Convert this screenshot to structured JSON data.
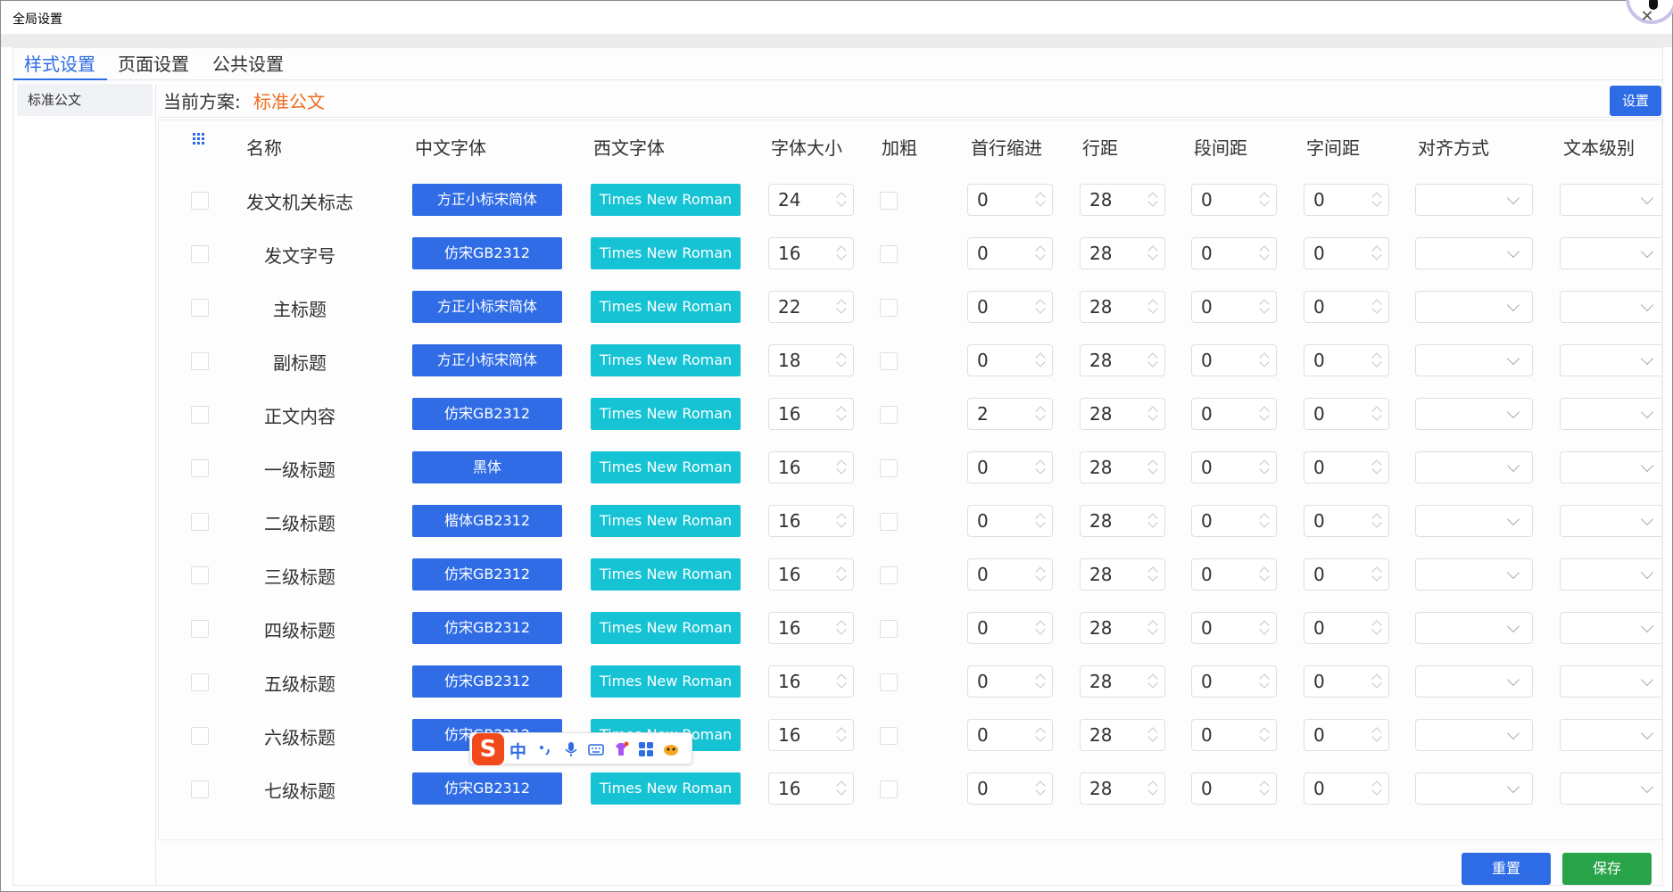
{
  "window": {
    "title": "全局设置"
  },
  "tabs": [
    {
      "label": "样式设置",
      "active": true
    },
    {
      "label": "页面设置",
      "active": false
    },
    {
      "label": "公共设置",
      "active": false
    }
  ],
  "sidebar": {
    "schemes": [
      "标准公文"
    ]
  },
  "scheme": {
    "label": "当前方案:",
    "value": "标准公文",
    "settings_button": "设置",
    "value_color": "#ef6b1f"
  },
  "table": {
    "headers": {
      "name": "名称",
      "cn_font": "中文字体",
      "en_font": "西文字体",
      "size": "字体大小",
      "bold": "加粗",
      "indent": "首行缩进",
      "line_spacing": "行距",
      "para_spacing": "段间距",
      "char_spacing": "字间距",
      "align": "对齐方式",
      "level": "文本级别"
    },
    "rows": [
      {
        "name": "发文机关标志",
        "cn_font": "方正小标宋简体",
        "en_font": "Times New Roman",
        "size": "24",
        "indent": "0",
        "line": "28",
        "para": "0",
        "char": "0"
      },
      {
        "name": "发文字号",
        "cn_font": "仿宋GB2312",
        "en_font": "Times New Roman",
        "size": "16",
        "indent": "0",
        "line": "28",
        "para": "0",
        "char": "0"
      },
      {
        "name": "主标题",
        "cn_font": "方正小标宋简体",
        "en_font": "Times New Roman",
        "size": "22",
        "indent": "0",
        "line": "28",
        "para": "0",
        "char": "0"
      },
      {
        "name": "副标题",
        "cn_font": "方正小标宋简体",
        "en_font": "Times New Roman",
        "size": "18",
        "indent": "0",
        "line": "28",
        "para": "0",
        "char": "0"
      },
      {
        "name": "正文内容",
        "cn_font": "仿宋GB2312",
        "en_font": "Times New Roman",
        "size": "16",
        "indent": "2",
        "line": "28",
        "para": "0",
        "char": "0"
      },
      {
        "name": "一级标题",
        "cn_font": "黑体",
        "en_font": "Times New Roman",
        "size": "16",
        "indent": "0",
        "line": "28",
        "para": "0",
        "char": "0"
      },
      {
        "name": "二级标题",
        "cn_font": "楷体GB2312",
        "en_font": "Times New Roman",
        "size": "16",
        "indent": "0",
        "line": "28",
        "para": "0",
        "char": "0"
      },
      {
        "name": "三级标题",
        "cn_font": "仿宋GB2312",
        "en_font": "Times New Roman",
        "size": "16",
        "indent": "0",
        "line": "28",
        "para": "0",
        "char": "0"
      },
      {
        "name": "四级标题",
        "cn_font": "仿宋GB2312",
        "en_font": "Times New Roman",
        "size": "16",
        "indent": "0",
        "line": "28",
        "para": "0",
        "char": "0"
      },
      {
        "name": "五级标题",
        "cn_font": "仿宋GB2312",
        "en_font": "Times New Roman",
        "size": "16",
        "indent": "0",
        "line": "28",
        "para": "0",
        "char": "0"
      },
      {
        "name": "六级标题",
        "cn_font": "仿宋GB2312",
        "en_font": "Times New Roman",
        "size": "16",
        "indent": "0",
        "line": "28",
        "para": "0",
        "char": "0"
      },
      {
        "name": "七级标题",
        "cn_font": "仿宋GB2312",
        "en_font": "Times New Roman",
        "size": "16",
        "indent": "0",
        "line": "28",
        "para": "0",
        "char": "0"
      }
    ]
  },
  "ime": {
    "logo": "S",
    "mode": "中"
  },
  "footer": {
    "reset": "重置",
    "save": "保存"
  },
  "colors": {
    "primary": "#2d6ce5",
    "cn_font_button": "#2f6ce5",
    "en_font_button": "#16c3d4",
    "save": "#2aa44a"
  }
}
